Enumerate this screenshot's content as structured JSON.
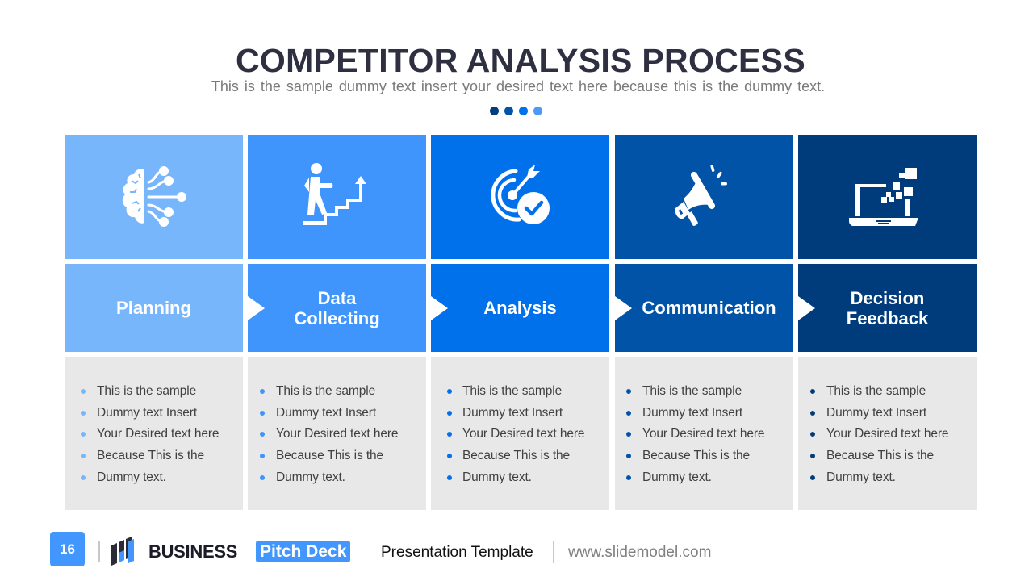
{
  "slide": {
    "title": "COMPETITOR ANALYSIS PROCESS",
    "subtitle": "This is the sample dummy text insert your desired text here because this is the dummy text.",
    "dots": [
      "#003e7e",
      "#0053a7",
      "#0070eb",
      "#4a9bf5"
    ]
  },
  "steps": [
    {
      "label_line1": "Planning",
      "label_line2": "",
      "icon": "brain-network-icon",
      "color": "#78b6fb",
      "bullet_color": "#78b6fb",
      "bullets": [
        "This is the sample",
        "Dummy text Insert",
        "Your Desired text here",
        "Because This is the",
        "Dummy text."
      ]
    },
    {
      "label_line1": "Data",
      "label_line2": "Collecting",
      "icon": "person-climbing-stairs-icon",
      "color": "#3f95fc",
      "bullet_color": "#3f95fc",
      "bullets": [
        "This is the sample",
        "Dummy text Insert",
        "Your Desired text here",
        "Because This is the",
        "Dummy text."
      ]
    },
    {
      "label_line1": "Analysis",
      "label_line2": "",
      "icon": "target-check-icon",
      "color": "#0070eb",
      "bullet_color": "#0070eb",
      "bullets": [
        "This is the sample",
        "Dummy text Insert",
        "Your Desired text here",
        "Because This is the",
        "Dummy text."
      ]
    },
    {
      "label_line1": "Communication",
      "label_line2": "",
      "icon": "megaphone-icon",
      "color": "#0053a7",
      "bullet_color": "#0053a7",
      "bullets": [
        "This is the sample",
        "Dummy text Insert",
        "Your Desired text here",
        "Because This is the",
        "Dummy text."
      ]
    },
    {
      "label_line1": "Decision",
      "label_line2": "Feedback",
      "icon": "laptop-pixels-icon",
      "color": "#003b7b",
      "bullet_color": "#003b7b",
      "bullets": [
        "This is the sample",
        "Dummy text Insert",
        "Your Desired text here",
        "Because This is the",
        "Dummy text."
      ]
    }
  ],
  "footer": {
    "page_number": "16",
    "brand": "BUSINESS",
    "brand_highlight": "Pitch Deck",
    "tagline": "Presentation Template",
    "website": "www.slidemodel.com"
  }
}
